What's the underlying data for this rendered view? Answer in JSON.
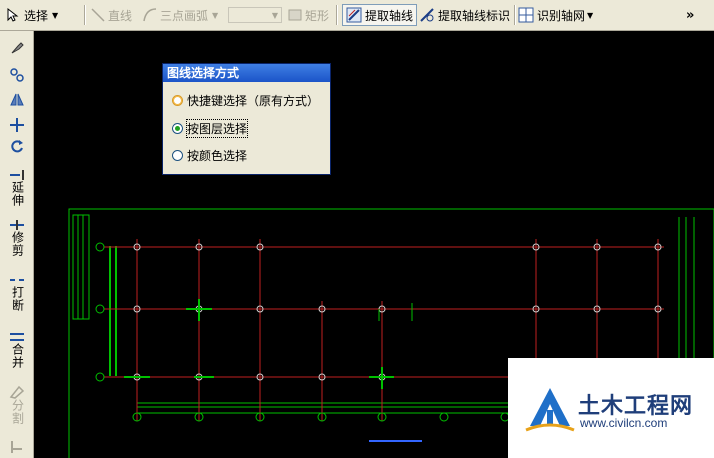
{
  "toolbar": {
    "select_label": "选择",
    "line_label": "直线",
    "arc_label": "三点画弧",
    "rect_label": "矩形",
    "extract_axis_label": "提取轴线",
    "extract_axis_mark_label": "提取轴线标识",
    "identify_grid_label": "识别轴网",
    "overflow_label": "»"
  },
  "left_toolbar": {
    "extend_label": "延伸",
    "trim_label": "修剪",
    "break_label": "打断",
    "merge_label": "合并",
    "split_label": "分割"
  },
  "dialog": {
    "title": "图线选择方式",
    "options": [
      {
        "label": "快捷键选择（原有方式）",
        "checked": false
      },
      {
        "label": "按图层选择",
        "checked": true
      },
      {
        "label": "按颜色选择",
        "checked": false
      }
    ]
  },
  "watermark": {
    "name": "土木工程网",
    "url": "www.civilcn.com"
  },
  "colors": {
    "canvas": "#000000",
    "axis_line": "#c02020",
    "frame_line": "#00c000",
    "toolbar": "#ece9d8",
    "dialog_title": "#1f5bd0"
  }
}
